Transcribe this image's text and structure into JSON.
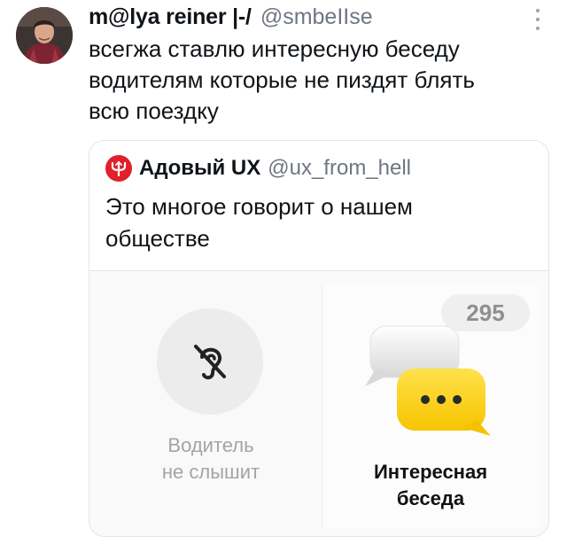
{
  "tweet": {
    "display_name": "m@lya reiner |-/",
    "handle": "@smbeIIse",
    "avatar_icon": "profile-photo",
    "more_icon": "vertical-ellipsis-icon",
    "text": "всегжа ставлю интересную беседу\nводителям которые не пиздят блять\nвсю поездку"
  },
  "quote": {
    "display_name": "Адовый UX",
    "handle": "@ux_from_hell",
    "logo_icon": "devil-trident-logo",
    "logo_color": "#e0202a",
    "text": "Это многое говорит о нашем\nобществе",
    "media": {
      "left_option": {
        "icon": "ear-off-icon",
        "label": "Водитель\nне слышит"
      },
      "right_option": {
        "icon": "chat-bubbles-icon",
        "count": "295",
        "label": "Интересная\nбеседа",
        "accent_color": "#ffd21f"
      }
    }
  }
}
